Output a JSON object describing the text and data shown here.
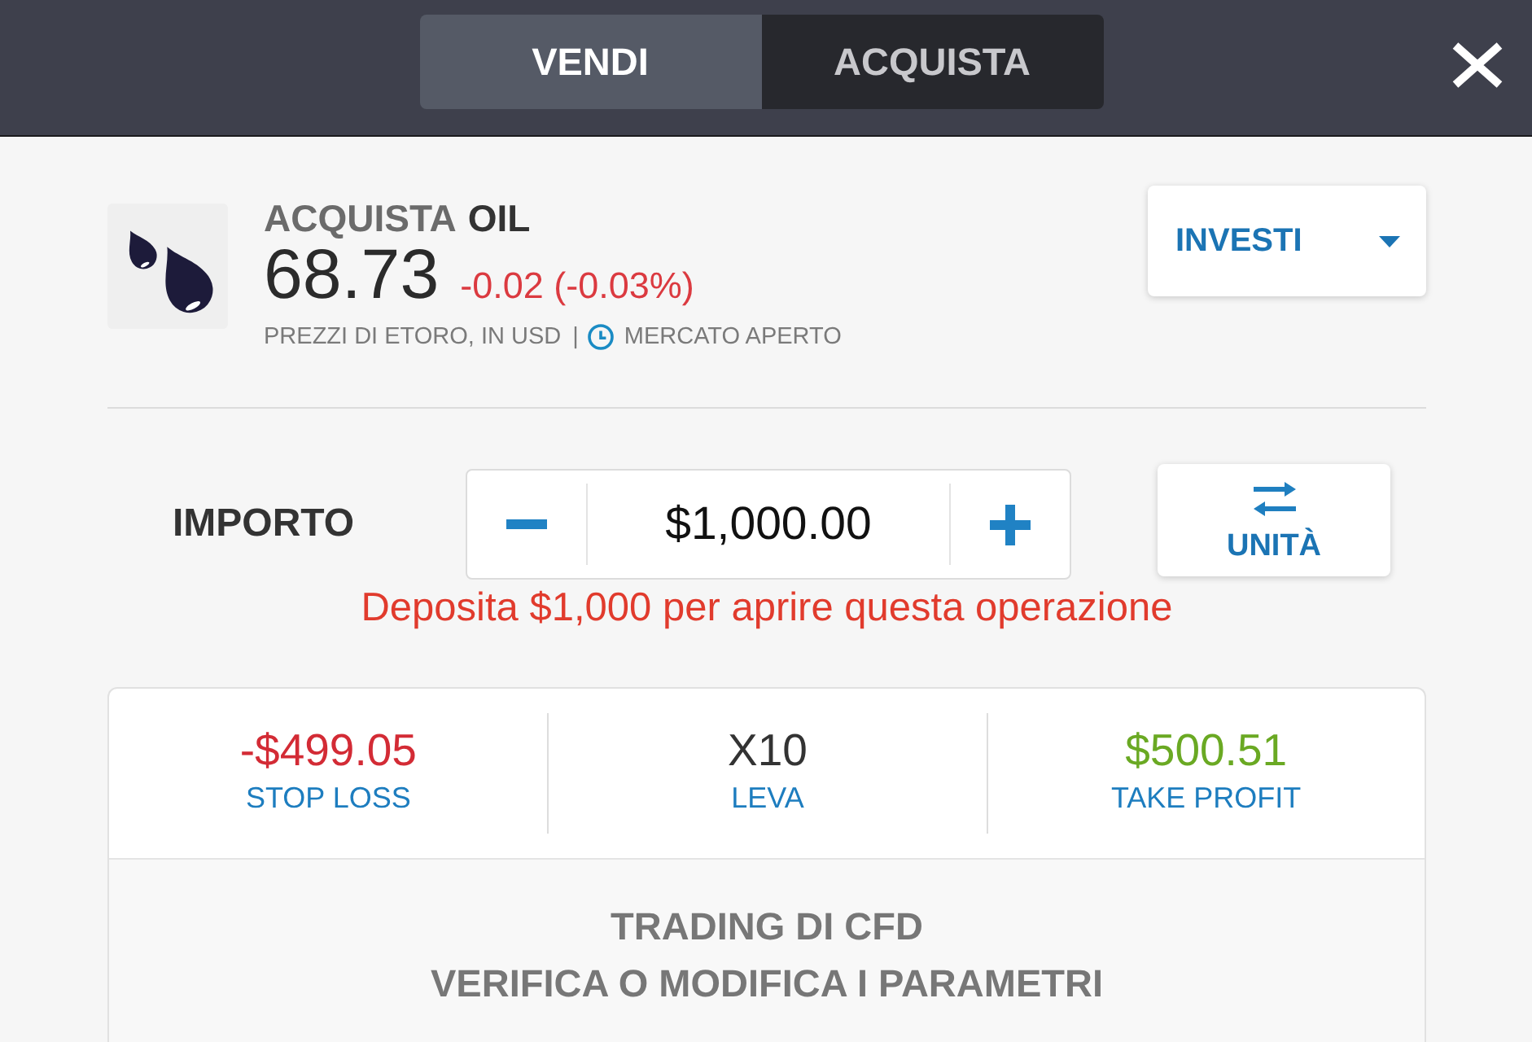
{
  "header": {
    "tabs": [
      {
        "label": "VENDI",
        "selected": false
      },
      {
        "label": "ACQUISTA",
        "selected": true
      }
    ]
  },
  "instrument": {
    "action": "ACQUISTA",
    "symbol": "OIL",
    "price": "68.73",
    "change": "-0.02 (-0.03%)",
    "source": "PREZZI DI ETORO, IN USD",
    "separator": "|",
    "market_status": "MERCATO APERTO"
  },
  "order_type": {
    "label": "INVESTI"
  },
  "amount": {
    "label": "IMPORTO",
    "value": "$1,000.00",
    "unit_toggle": "UNITÀ",
    "warning": "Deposita $1,000 per aprire questa operazione"
  },
  "parameters": [
    {
      "value": "-$499.05",
      "label": "STOP LOSS",
      "color": "#d32b35"
    },
    {
      "value": "X10",
      "label": "LEVA",
      "color": "#333333"
    },
    {
      "value": "$500.51",
      "label": "TAKE PROFIT",
      "color": "#6aa923"
    }
  ],
  "review": {
    "lines": [
      "TRADING DI CFD",
      "VERIFICA O MODIFICA I PARAMETRI"
    ]
  }
}
